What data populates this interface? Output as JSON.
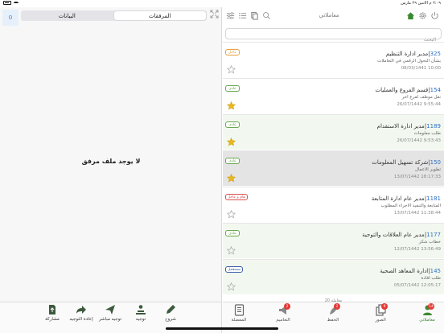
{
  "status_bar": {
    "time": "٢:٠٩ م  الاثنين ٢٩ مارس"
  },
  "attachments": {
    "count": "0",
    "segments": [
      {
        "label": "المرفقات",
        "active": true
      },
      {
        "label": "البيانات",
        "active": false
      }
    ],
    "empty_message": "لا يوجد ملف مرفق"
  },
  "header": {
    "title": "معاملاتي"
  },
  "search": {
    "placeholder": "البحث"
  },
  "items": [
    {
      "num": "325",
      "title": "مدير ادارة التنظيم",
      "subject": "بشأن التحول الرقمي في التعاملات",
      "date": "08/03/1441 10:00",
      "tag": "عاجل",
      "tag_color": "orange",
      "starred": false,
      "bg": "white"
    },
    {
      "num": "154",
      "title": "قسم الفروع والعمليات",
      "subject": "نقل موظف لفرع اخر",
      "date": "26/07/1442 9:55:44",
      "tag": "عادي",
      "tag_color": "green",
      "starred": true,
      "bg": "white"
    },
    {
      "num": "1189",
      "title": "مدير ادارة الاستقدام",
      "subject": "طلب معلومات",
      "date": "26/07/1442 9:53:43",
      "tag": "عادي",
      "tag_color": "green",
      "starred": true,
      "bg": "green"
    },
    {
      "num": "150",
      "title": "شركة تسهيل المعلومات",
      "subject": "تطوير الاعمال",
      "date": "13/07/1442 18:17:33",
      "tag": "عادي",
      "tag_color": "green",
      "starred": true,
      "bg": "selected"
    },
    {
      "num": "1181",
      "title": "مدير عام ادارة المتابعة",
      "subject": "المتابعة والتنفيذ الاجراء المطلوب",
      "date": "13/07/1442 11:38:44",
      "tag": "هام و عاجل",
      "tag_color": "red",
      "starred": false,
      "bg": "white"
    },
    {
      "num": "1177",
      "title": "مدير عام العلاقات والتوجية",
      "subject": "خطاب شكر",
      "date": "12/07/1442 13:56:49",
      "tag": "عادي",
      "tag_color": "green",
      "starred": false,
      "bg": "green"
    },
    {
      "num": "145",
      "title": "ادارة المعاهد الصحية",
      "subject": "طلب افادة",
      "date": "05/07/1442 12:05:17",
      "tag": "مستعجل",
      "tag_color": "blue",
      "starred": false,
      "bg": "green"
    }
  ],
  "list_count": "20 معاملة",
  "actions": [
    {
      "label": "مشاركة",
      "icon": "share-file-icon"
    },
    {
      "label": "إعادة التوجيه",
      "icon": "forward-arrow-icon"
    },
    {
      "label": "توجيه مباشر",
      "icon": "send-plane-icon"
    },
    {
      "label": "توجيه",
      "icon": "route-users-icon"
    },
    {
      "label": "شروح",
      "icon": "pen-icon"
    }
  ],
  "tabs": [
    {
      "label": "المفضلة",
      "icon": "favorites-doc-icon",
      "badge": ""
    },
    {
      "label": "التعاميم",
      "icon": "megaphone-icon",
      "badge": "2"
    },
    {
      "label": "الحفظ",
      "icon": "feather-icon",
      "badge": "2"
    },
    {
      "label": "الصور",
      "icon": "copies-icon",
      "badge": "9"
    },
    {
      "label": "معاملاتي",
      "icon": "user-icon",
      "badge": "14",
      "active": true
    }
  ],
  "colors": {
    "accent_green": "#3a8a2f",
    "link_blue": "#2f6fc5",
    "badge_red": "#e53935"
  }
}
